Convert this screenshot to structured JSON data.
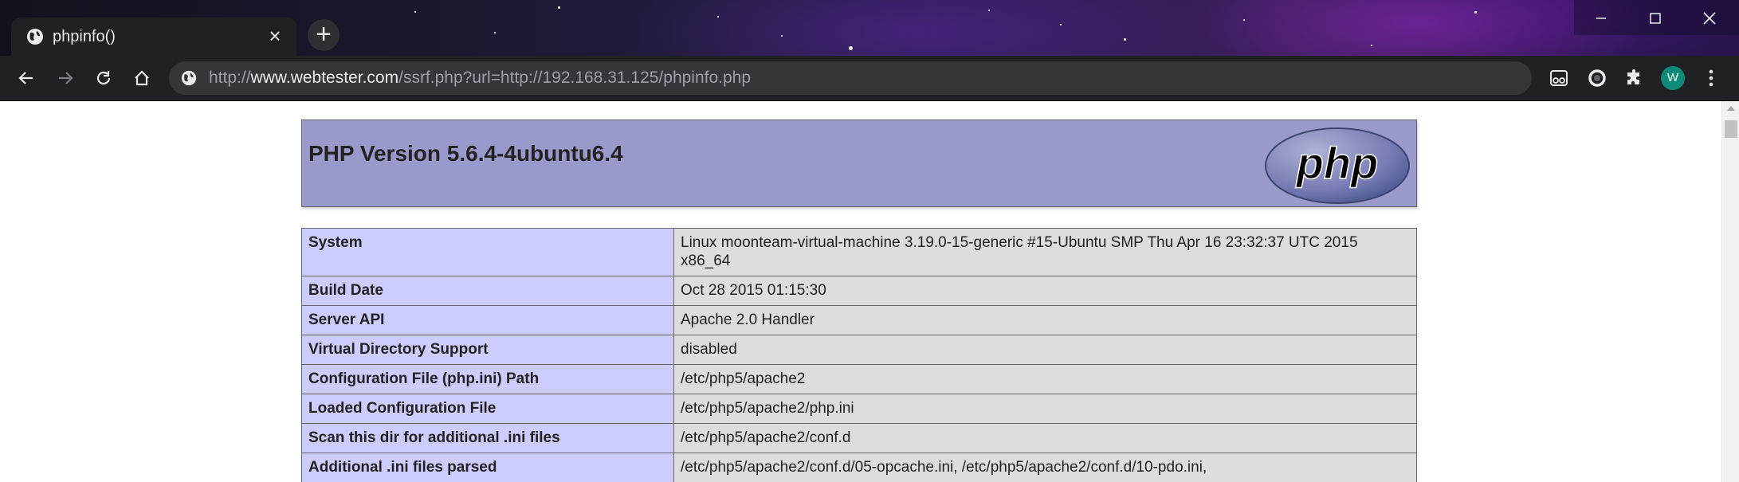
{
  "browser": {
    "tab_title": "phpinfo()",
    "tab_close": "×",
    "new_tab": "+",
    "url_scheme": "http://",
    "url_host": "www.webtester.com",
    "url_path": "/ssrf.php?url=http://192.168.31.125/phpinfo.php",
    "profile_initial": "W",
    "accent_color": "#0e8a78"
  },
  "page": {
    "title": "PHP Version 5.6.4-4ubuntu6.4",
    "logo_text": "php",
    "rows": [
      {
        "label": "System",
        "value": "Linux moonteam-virtual-machine 3.19.0-15-generic #15-Ubuntu SMP Thu Apr 16 23:32:37 UTC 2015 x86_64"
      },
      {
        "label": "Build Date",
        "value": "Oct 28 2015 01:15:30"
      },
      {
        "label": "Server API",
        "value": "Apache 2.0 Handler"
      },
      {
        "label": "Virtual Directory Support",
        "value": "disabled"
      },
      {
        "label": "Configuration File (php.ini) Path",
        "value": "/etc/php5/apache2"
      },
      {
        "label": "Loaded Configuration File",
        "value": "/etc/php5/apache2/php.ini"
      },
      {
        "label": "Scan this dir for additional .ini files",
        "value": "/etc/php5/apache2/conf.d"
      },
      {
        "label": "Additional .ini files parsed",
        "value": "/etc/php5/apache2/conf.d/05-opcache.ini, /etc/php5/apache2/conf.d/10-pdo.ini,"
      }
    ],
    "colors": {
      "header_bg": "#9999cc",
      "label_bg": "#ccccff",
      "value_bg": "#dddddd"
    }
  }
}
